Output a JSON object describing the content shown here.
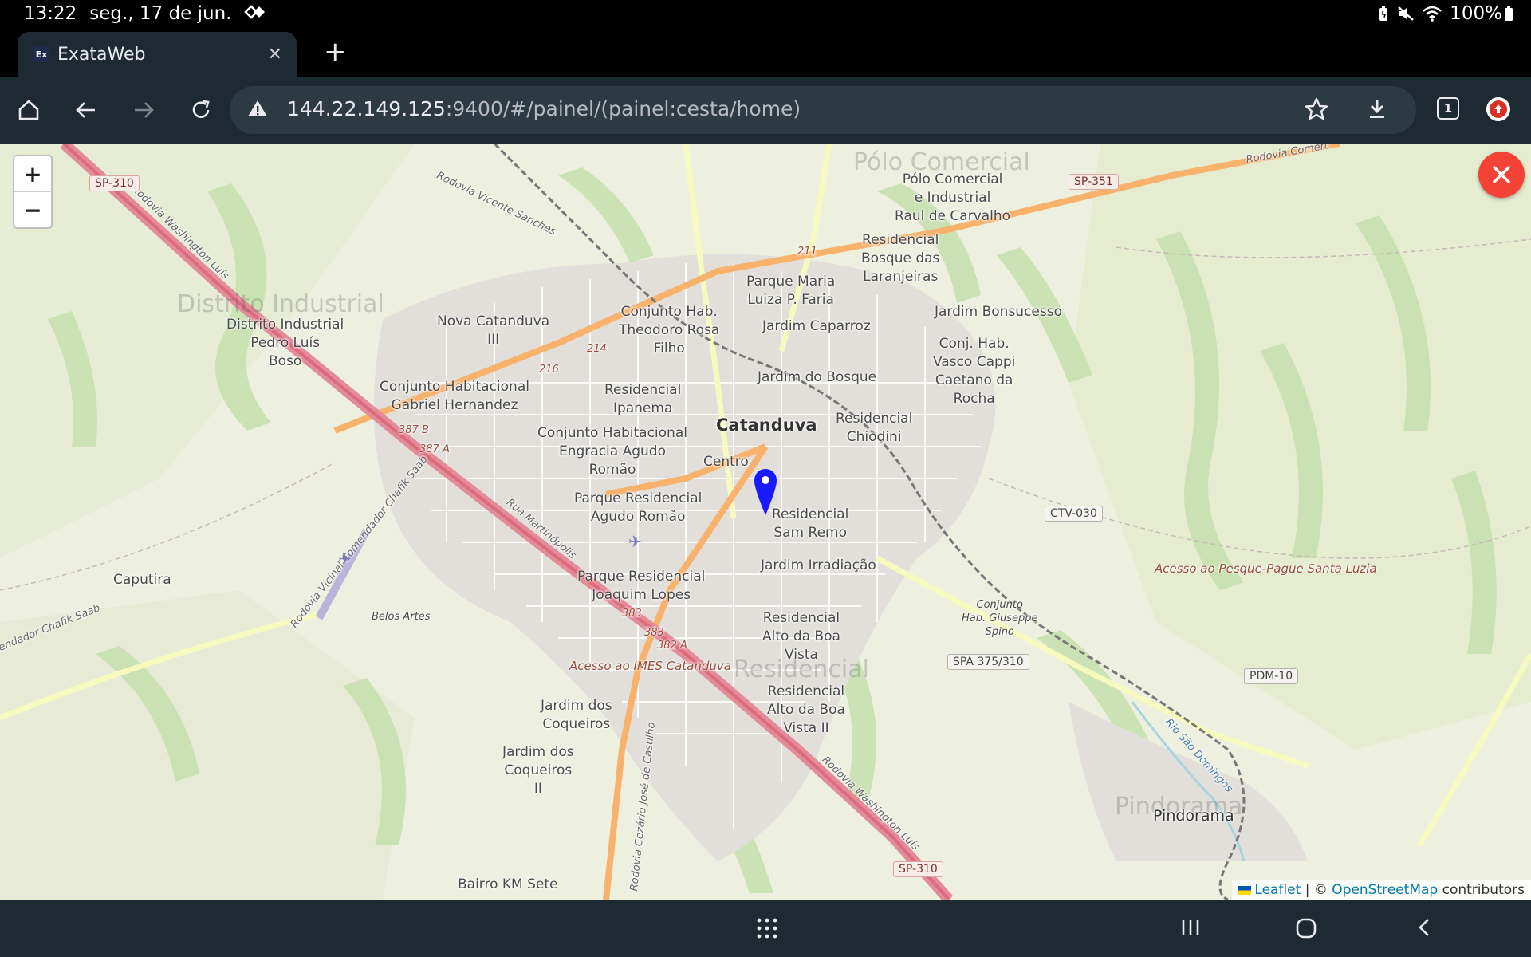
{
  "status_bar": {
    "time": "13:22",
    "date": "seg., 17 de jun.",
    "battery": "100%",
    "icons": [
      "dual-diamond-icon",
      "battery-saver-icon",
      "mute-icon",
      "wifi-icon",
      "battery-icon"
    ]
  },
  "browser": {
    "tab": {
      "title": "ExataWeb",
      "favicon_text": "Ex"
    },
    "url_host": "144.22.149.125",
    "url_rest": ":9400/#/painel/(painel:cesta/home)",
    "tab_count": "1",
    "accent": "#1e2a31"
  },
  "map": {
    "zoom_in": "+",
    "zoom_out": "−",
    "labels": {
      "polo_comercial": "Pólo Comercial\ne Industrial\nRaul de Carvalho",
      "residencial_bosque": "Residencial\nBosque das\nLaranjeiras",
      "parque_maria": "Parque Maria\nLuiza P. Faria",
      "jardim_caparroz": "Jardim Caparroz",
      "jardim_bonsucesso": "Jardim Bonsucesso",
      "conj_vasco": "Conj. Hab.\nVasco Cappi\nCaetano da\nRocha",
      "distrito_industrial": "Distrito Industrial\nPedro Luís\nBoso",
      "nova_catanduva": "Nova Catanduva\nIII",
      "conjunto_theodoro": "Conjunto Hab.\nTheodoro Rosa\nFilho",
      "jardim_bosque": "Jardim do Bosque",
      "conjunto_gabriel": "Conjunto Habitacional\nGabriel Hernandez",
      "residencial_ipanema": "Residencial\nIpanema",
      "catanduva": "Catanduva",
      "residencial_chiodini": "Residencial\nChiodini",
      "conjunto_engracia": "Conjunto Habitacional\nEngracia Agudo\nRomão",
      "centro": "Centro",
      "parque_agudo": "Parque Residencial\nAgudo Romão",
      "residencial_sam_remo": "Residencial\nSam Remo",
      "jardim_irradiacao": "Jardim Irradiação",
      "caputira": "Caputira",
      "parque_joaquim": "Parque Residencial\nJoaquim Lopes",
      "belos_artes": "Belos Artes",
      "residencial_alto": "Residencial\nAlto da Boa\nVista",
      "residencial_alto_ii": "Residencial\nAlto da Boa\nVista II",
      "jardim_coqueiros": "Jardim dos\nCoqueiros",
      "jardim_coqueiros_ii": "Jardim dos\nCoqueiros\nII",
      "bairro_km_sete": "Bairro KM Sete",
      "pindorama": "Pindorama",
      "conjunto_spino": "Conjunto\nHab. Giuseppe\nSpino",
      "acesso_pesque": "Acesso ao Pesque-Pague Santa Luzia",
      "acesso_imes": "Acesso ao IMES Catanduva",
      "rod_washington_1": "Rodovia Washington Luís",
      "rod_washington_2": "Rodovia Washington Luís",
      "rod_vicente": "Rodovia Vicente Sanches",
      "rod_chafik": "Rodovia Vicinal Comendador Chafik Saab",
      "rod_chafik_2": "endador Chafik Saab",
      "rua_martinopolis": "Rua Martinópolis",
      "rod_comercial": "Rodovia Comerc",
      "rod_cezario": "Rodovia Cezário José de Castilho",
      "rio_sao_domingos": "Rio São Domingos",
      "r214": "214",
      "r216": "216",
      "r211": "211",
      "r387b": "387 B",
      "r387a": "387 A",
      "r383": "383",
      "r383b": "383",
      "r382a": "382 A"
    },
    "shields": {
      "sp310_top": "SP-310",
      "sp351": "SP-351",
      "ctv030": "CTV-030",
      "spa375": "SPA 375/310",
      "pdm010": "PDM-10",
      "sp310_bottom": "SP-310"
    },
    "ghost_labels": {
      "g1": "Pólo Comercial",
      "g2": "Distrito Industrial",
      "g3": "Pindorama",
      "g4": "Residencial"
    },
    "attribution": {
      "leaflet": "Leaflet",
      "sep": "| ©",
      "osm": "OpenStreetMap",
      "contributors": "contributors"
    },
    "marker_color": "#1a1aff",
    "close_button_color": "#f44336"
  }
}
